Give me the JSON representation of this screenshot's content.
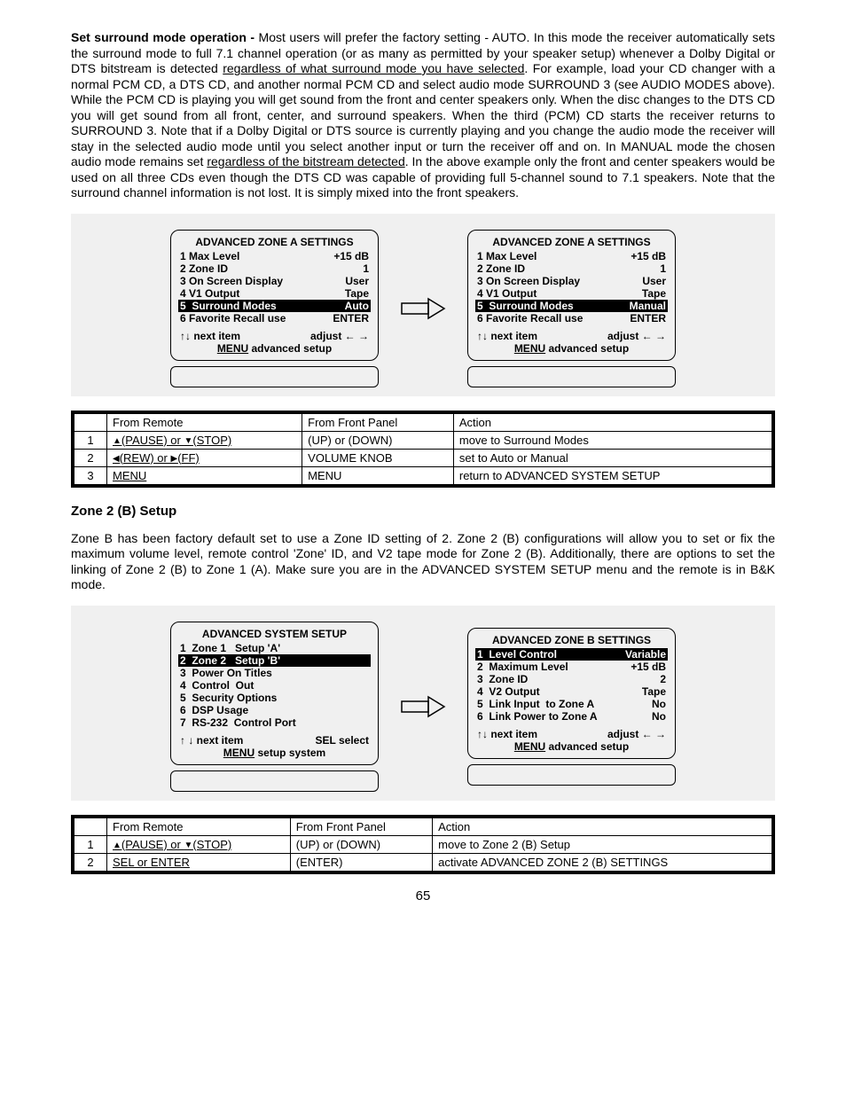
{
  "para1": {
    "lead": "Set surround mode operation - ",
    "t1": "Most users will prefer the factory setting - AUTO. In this mode the receiver automatically sets the surround mode to full 7.1 channel operation (or as many as permitted by your speaker setup) whenever a Dolby Digital or DTS bitstream is detected ",
    "u1": "regardless of what surround mode you have selected",
    "t2": ". For example, load your CD changer with a normal PCM CD, a DTS CD, and another normal PCM CD and select audio mode SURROUND 3 (see AUDIO MODES above). While the PCM CD is playing you will get sound from the front and center speakers only. When the disc changes to the DTS CD you will get sound from all front, center, and surround speakers. When the third (PCM) CD starts the receiver returns to SURROUND 3. Note that if a Dolby Digital or DTS source is currently playing and you change the audio mode the receiver will stay in the selected audio mode until you select another input or turn the receiver off and on. In MANUAL mode the chosen audio mode remains set ",
    "u2": "regardless of the bitstream detected",
    "t3": ". In the above example only the front and center speakers would be used on all three CDs even though the DTS CD was capable of providing full 5-channel sound to 7.1 speakers. Note that the surround channel information is not lost. It is simply mixed into the front speakers."
  },
  "panelA_left": {
    "title": "ADVANCED ZONE A SETTINGS",
    "rows": [
      {
        "l": "1 Max Level",
        "r": "+15 dB",
        "hl": false
      },
      {
        "l": "2 Zone ID",
        "r": "1",
        "hl": false
      },
      {
        "l": "3 On Screen Display",
        "r": "User",
        "hl": false
      },
      {
        "l": "4 V1 Output",
        "r": "Tape",
        "hl": false
      },
      {
        "l": "5  Surround Modes",
        "r": "Auto",
        "hl": true
      },
      {
        "l": "6 Favorite Recall use",
        "r": "ENTER",
        "hl": false
      }
    ],
    "foot_left": "↑↓    next item",
    "foot_right": "adjust ← →",
    "foot2a": "MENU",
    "foot2b": "  advanced setup"
  },
  "panelA_right": {
    "title": "ADVANCED ZONE A SETTINGS",
    "rows": [
      {
        "l": "1 Max Level",
        "r": "+15 dB",
        "hl": false
      },
      {
        "l": "2 Zone ID",
        "r": "1",
        "hl": false
      },
      {
        "l": "3 On Screen Display",
        "r": "User",
        "hl": false
      },
      {
        "l": "4 V1 Output",
        "r": "Tape",
        "hl": false
      },
      {
        "l": "5  Surround Modes",
        "r": "Manual",
        "hl": true
      },
      {
        "l": "6 Favorite Recall use",
        "r": "ENTER",
        "hl": false
      }
    ],
    "foot_left": "↑↓    next item",
    "foot_right": "adjust ← →",
    "foot2a": "MENU",
    "foot2b": "  advanced setup"
  },
  "table1": {
    "headers": [
      "",
      "From Remote",
      "From Front Panel",
      "Action"
    ],
    "rows": [
      {
        "n": "1",
        "remote_pre": "▲",
        "remote_mid": "(PAUSE) or ",
        "remote_pre2": "▼",
        "remote_post": "(STOP)",
        "fp": "(UP) or (DOWN)",
        "act": "move to Surround Modes"
      },
      {
        "n": "2",
        "remote_pre": "◀",
        "remote_mid": "(REW) or ",
        "remote_pre2": "▶",
        "remote_post": "(FF)",
        "fp": "VOLUME KNOB",
        "act": "set to Auto or Manual"
      },
      {
        "n": "3",
        "remote_plain": "MENU",
        "fp": "MENU",
        "act": "return to ADVANCED SYSTEM SETUP"
      }
    ]
  },
  "section2_title": "Zone 2 (B) Setup",
  "para2": "Zone B has been factory default set to use a Zone ID setting of 2. Zone 2 (B) configurations will allow you to set or fix the maximum volume level, remote control 'Zone' ID, and V2 tape mode for Zone 2 (B). Additionally, there are options to set the linking of Zone 2 (B) to Zone 1 (A). Make sure you are in the ADVANCED SYSTEM SETUP menu and the remote is in B&K mode.",
  "panelB_left": {
    "title": "ADVANCED SYSTEM SETUP",
    "rows": [
      {
        "l": "1  Zone 1   Setup 'A'",
        "r": "",
        "hl": false
      },
      {
        "l": "2  Zone 2   Setup 'B'",
        "r": "",
        "hl": true
      },
      {
        "l": "3  Power On Titles",
        "r": "",
        "hl": false
      },
      {
        "l": "4  Control  Out",
        "r": "",
        "hl": false
      },
      {
        "l": "5  Security Options",
        "r": "",
        "hl": false
      },
      {
        "l": "6  DSP Usage",
        "r": "",
        "hl": false
      },
      {
        "l": "7  RS-232  Control Port",
        "r": "",
        "hl": false
      }
    ],
    "foot_left": "↑ ↓    next item",
    "foot_right": "SEL  select",
    "foot2a": "MENU",
    "foot2b": " setup system"
  },
  "panelB_right": {
    "title": "ADVANCED ZONE B SETTINGS",
    "rows": [
      {
        "l": "1  Level Control",
        "r": "Variable",
        "hl": true
      },
      {
        "l": "2  Maximum Level",
        "r": "+15 dB",
        "hl": false
      },
      {
        "l": "3  Zone ID",
        "r": "2",
        "hl": false
      },
      {
        "l": "4  V2 Output",
        "r": "Tape",
        "hl": false
      },
      {
        "l": "5  Link Input  to Zone A",
        "r": "No",
        "hl": false
      },
      {
        "l": "6  Link Power to Zone A",
        "r": "No",
        "hl": false
      }
    ],
    "foot_left": "↑↓ next item",
    "foot_right": "adjust  ← →",
    "foot2a": "MENU",
    "foot2b": " advanced setup"
  },
  "table2": {
    "headers": [
      "",
      "From Remote",
      "From Front Panel",
      "Action"
    ],
    "rows": [
      {
        "n": "1",
        "remote_pre": "▲",
        "remote_mid": "(PAUSE) or ",
        "remote_pre2": "▼",
        "remote_post": "(STOP)",
        "fp": "(UP) or (DOWN)",
        "act": "move to Zone 2 (B) Setup"
      },
      {
        "n": "2",
        "remote_plain": "SEL or ENTER",
        "fp": "(ENTER)",
        "act": "activate ADVANCED ZONE 2 (B) SETTINGS"
      }
    ]
  },
  "page_number": "65"
}
